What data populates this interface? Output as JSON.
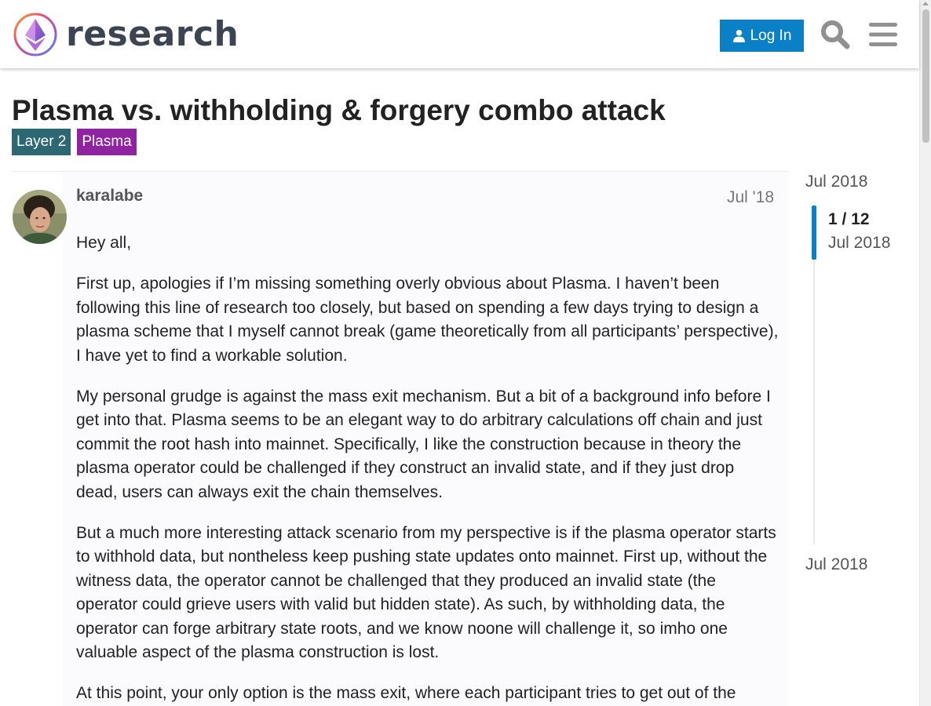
{
  "header": {
    "logo_text": "research",
    "login_label": "Log In",
    "search_icon": "search-icon",
    "menu_icon": "hamburger-menu-icon"
  },
  "topic": {
    "title": "Plasma vs. withholding & forgery combo attack",
    "tags": [
      {
        "label": "Layer 2",
        "color": "#2c6772"
      },
      {
        "label": "Plasma",
        "color": "#8e24a0"
      }
    ]
  },
  "post": {
    "username": "karalabe",
    "date": "Jul '18",
    "paragraphs": [
      "Hey all,",
      "First up, apologies if I’m missing something overly obvious about Plasma. I haven’t been following this line of research too closely, but based on spending a few days trying to design a plasma scheme that I myself cannot break (game theoretically from all participants’ perspective), I have yet to find a workable solution.",
      "My personal grudge is against the mass exit mechanism. But a bit of a background info before I get into that. Plasma seems to be an elegant way to do arbitrary calculations off chain and just commit the root hash into mainnet. Specifically, I like the construction because in theory the plasma operator could be challenged if they construct an invalid state, and if they just drop dead, users can always exit the chain themselves.",
      "But a much more interesting attack scenario from my perspective is if the plasma operator starts to withhold data, but nontheless keep pushing state updates onto mainnet. First up, without the witness data, the operator cannot be challenged that they produced an invalid state (the operator could grieve users with valid but hidden state). As such, by withholding data, the operator can forge arbitrary state roots, and we know noone will challenge it, so imho one valuable aspect of the plasma construction is lost.",
      "At this point, your only option is the mass exit, where each participant tries to get out of the"
    ]
  },
  "timeline": {
    "start_label": "Jul 2018",
    "position_label": "1 / 12",
    "position_date": "Jul 2018",
    "end_label": "Jul 2018"
  },
  "colors": {
    "accent": "#0a81c6",
    "tag_layer2": "#2c6772",
    "tag_plasma": "#8e24a0"
  }
}
